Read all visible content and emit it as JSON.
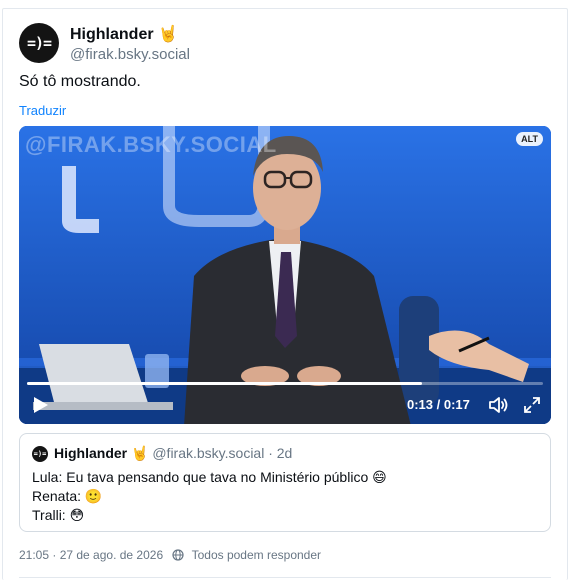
{
  "author": {
    "display_name": "Highlander 🤘",
    "handle": "@firak.bsky.social",
    "avatar_text": "=)="
  },
  "post": {
    "text": "Só tô mostrando.",
    "translate_label": "Traduzir"
  },
  "video": {
    "watermark": "@FIRAK.BSKY.SOCIAL",
    "alt_badge": "ALT",
    "time_readout": "0:13 / 0:17",
    "progress_fraction": 0.765
  },
  "quoted_post": {
    "avatar_text": "=)=",
    "display_name": "Highlander 🤘",
    "handle": "@firak.bsky.social",
    "age": "· 2d",
    "lines": [
      "Lula: Eu tava pensando que tava no Ministério público 😄",
      "Renata: 🙂",
      "Tralli: 😳"
    ]
  },
  "footer": {
    "timestamp": "21:05 · 27 de ago. de 2026",
    "reply_setting": "Todos podem responder"
  },
  "colors": {
    "link": "#1083fe",
    "muted": "#687684",
    "border": "#e3e8ee",
    "video_blue": "#1c62d6"
  }
}
